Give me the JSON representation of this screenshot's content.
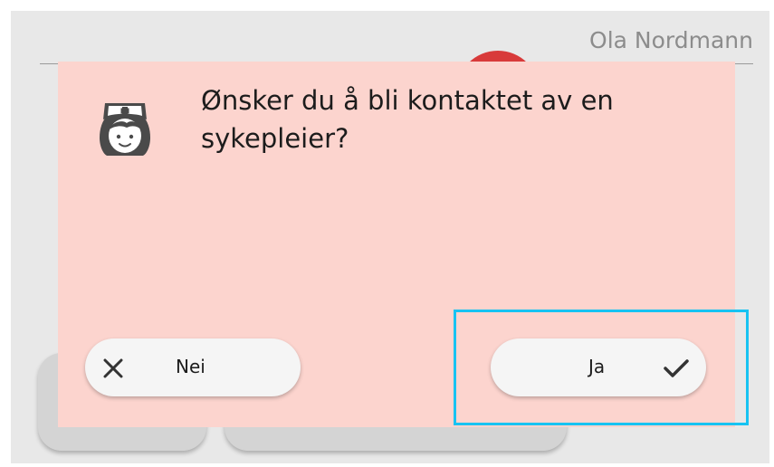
{
  "header": {
    "user_name": "Ola Nordmann"
  },
  "dialog": {
    "icon": "nurse-icon",
    "question": "Ønsker du å bli kontaktet av en sykepleier?",
    "no_button": {
      "label": "Nei",
      "icon": "close-icon"
    },
    "yes_button": {
      "label": "Ja",
      "icon": "checkmark-icon"
    }
  },
  "colors": {
    "dialog_background": "#fcd4ce",
    "highlight_border": "#17c3f2",
    "accent_red": "#d83a3a"
  }
}
